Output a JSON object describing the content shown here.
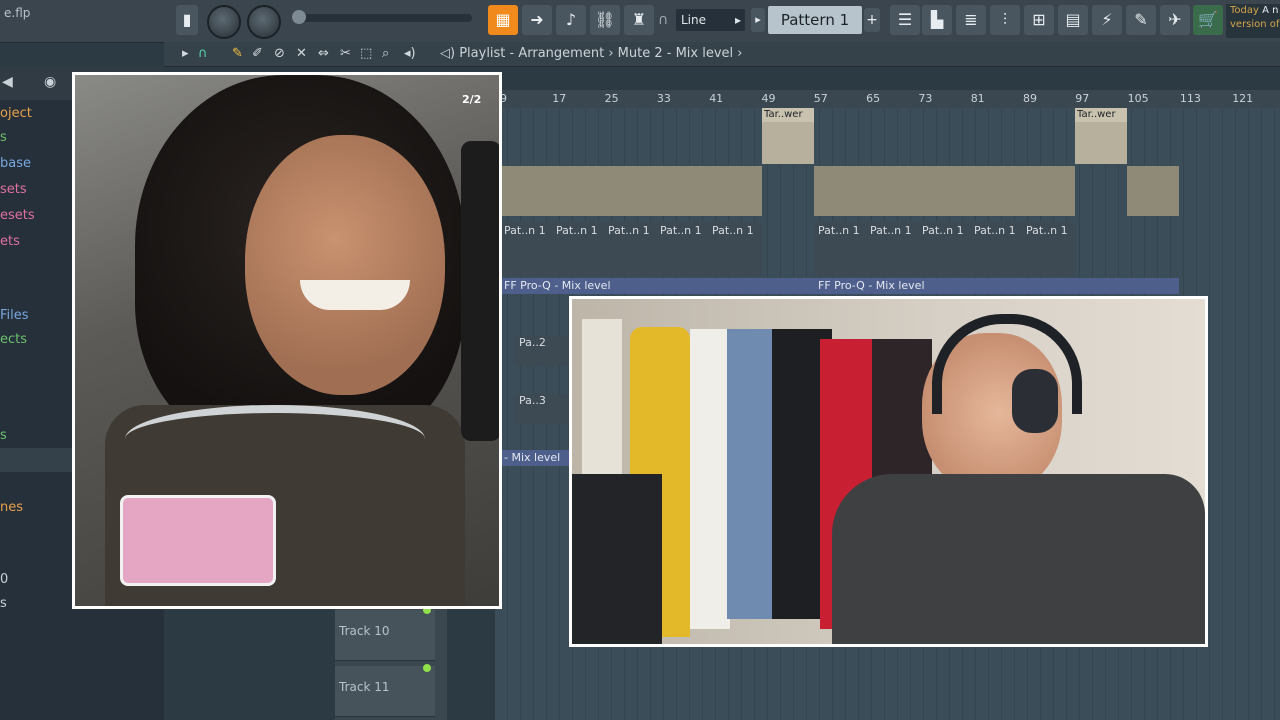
{
  "toolbar": {
    "filename": "e.flp",
    "snap_mode": "Line",
    "pattern": "Pattern 1",
    "news_line1": "Today",
    "news_line2": "version of",
    "news_extra": "A n"
  },
  "playlist": {
    "breadcrumb": "Playlist - Arrangement",
    "breadcrumb_sep": "›",
    "breadcrumb_target": "Mute 2 - Mix level",
    "ruler": [
      "9",
      "17",
      "25",
      "33",
      "41",
      "49",
      "57",
      "65",
      "73",
      "81",
      "89",
      "97",
      "105",
      "113",
      "121"
    ],
    "clip_tar": "Tar..wer",
    "clip_pat": "Pat..n 1",
    "clip_pa2": "Pa..2",
    "clip_pa3": "Pa..3",
    "automation_label": "FF Pro-Q - Mix level",
    "automation_label_short": "- Mix level",
    "tracks": [
      "Track 10",
      "Track 11"
    ]
  },
  "browser": {
    "items": [
      "oject",
      "s",
      "base",
      "sets",
      "esets",
      "ets",
      "Files",
      "ects",
      "s",
      "nes",
      "0",
      "s"
    ],
    "colors": [
      "#e8a04a",
      "#6cc06c",
      "#78a8e0",
      "#e070a0",
      "#e070a0",
      "#e070a0",
      "#78a8e0",
      "#6cc06c",
      "#6cc06c",
      "#e8a04a",
      "#c9d2d7",
      "#c9d2d7"
    ]
  },
  "overlay": {
    "counter": "2/2"
  },
  "colors": {
    "accent": "#f08a1c",
    "automation": "#4e5f8c",
    "grid": "#3a4d59"
  }
}
